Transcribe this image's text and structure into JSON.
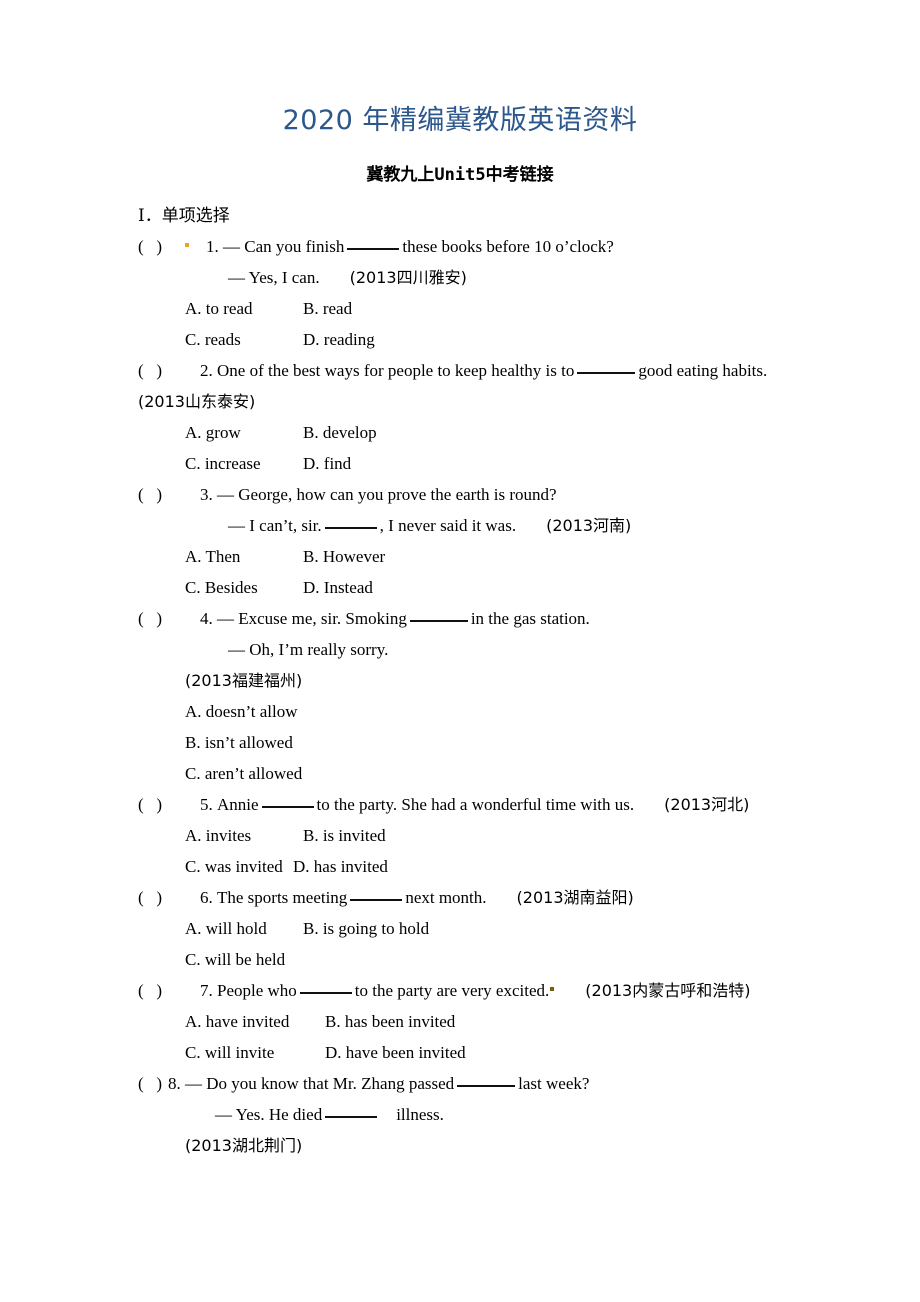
{
  "banner": "2020 年精编冀教版英语资料",
  "doc_title": "冀教九上Unit5中考链接",
  "section": {
    "label": "Ⅰ．单项选择"
  },
  "marker": {
    "open": "(",
    "close": ")",
    "dash": "—"
  },
  "questions": [
    {
      "number": "1.",
      "stem_pre": "— Can you finish",
      "stem_post": "these books before  10 o’clock?",
      "reply": "— Yes, I can.",
      "source": "(2013四川雅安)",
      "source_inline": true,
      "options": [
        {
          "key": "A.",
          "text": "A. to read"
        },
        {
          "key": "B.",
          "text": "B. read"
        },
        {
          "key": "C.",
          "text": "C. reads"
        },
        {
          "key": "D.",
          "text": "D. reading"
        }
      ]
    },
    {
      "number": "2.",
      "stem_pre": "One of the best ways for people to keep healthy is to",
      "stem_post": "good eating habits.",
      "source": "(2013山东泰安)",
      "options": [
        {
          "key": "A.",
          "text": "A. grow"
        },
        {
          "key": "B.",
          "text": "B. develop"
        },
        {
          "key": "C.",
          "text": "C. increase"
        },
        {
          "key": "D.",
          "text": "D. find"
        }
      ]
    },
    {
      "number": "3.",
      "stem": "— George, how can you prove the earth is round?",
      "reply_pre": "— I can’t, sir.",
      "reply_post": ", I never said it was.",
      "source": "(2013河南)",
      "options": [
        {
          "key": "A.",
          "text": "A. Then"
        },
        {
          "key": "B.",
          "text": "B. However"
        },
        {
          "key": "C.",
          "text": "C. Besides"
        },
        {
          "key": "D.",
          "text": "D. Instead"
        }
      ]
    },
    {
      "number": "4.",
      "stem_pre": "— Excuse me, sir. Smoking",
      "stem_post": "in the gas station.",
      "reply": "— Oh, I’m really sorry.",
      "source": "(2013福建福州)",
      "options": [
        {
          "key": "A.",
          "text": "A. doesn’t allow"
        },
        {
          "key": "B.",
          "text": "B. isn’t allowed"
        },
        {
          "key": "C.",
          "text": "C. aren’t allowed"
        }
      ]
    },
    {
      "number": "5.",
      "stem_pre": "Annie",
      "stem_post": "to the party. She had a wonderful time with us.",
      "source": "(2013河北)",
      "options": [
        {
          "key": "A.",
          "text": "A. invites"
        },
        {
          "key": "B.",
          "text": "B. is invited"
        },
        {
          "key": "C.",
          "text": "C. was invited"
        },
        {
          "key": "D.",
          "text": "D. has invited"
        }
      ]
    },
    {
      "number": "6.",
      "stem_pre": "The sports meeting",
      "stem_post": "next month.",
      "source": "(2013湖南益阳)",
      "options": [
        {
          "key": "A.",
          "text": "A. will hold"
        },
        {
          "key": "B.",
          "text": "B. is going to hold"
        },
        {
          "key": "C.",
          "text": "C. will be held"
        }
      ]
    },
    {
      "number": "7.",
      "stem_pre": "People who",
      "stem_post": "to the party are very excited.",
      "source": "(2013内蒙古呼和浩特)",
      "options": [
        {
          "key": "A.",
          "text": "A. have invited"
        },
        {
          "key": "B.",
          "text": "B. has been invited"
        },
        {
          "key": "C.",
          "text": "C. will invite"
        },
        {
          "key": "D.",
          "text": "D. have been invited"
        }
      ]
    },
    {
      "number": "8.",
      "stem_pre": "— Do you know that Mr. Zhang passed",
      "stem_post": "last week?",
      "reply_pre": "— Yes. He died",
      "reply_post": "illness.",
      "source": "(2013湖北荆门)",
      "options": []
    }
  ],
  "colors": {
    "banner": "#2c578c",
    "text": "#000000",
    "background": "#ffffff",
    "speckle": "#e8a32a"
  }
}
